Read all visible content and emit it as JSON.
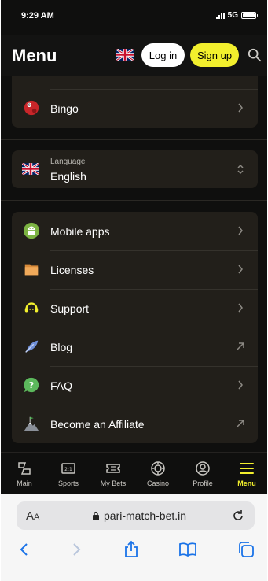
{
  "status": {
    "time": "9:29 AM",
    "network": "5G"
  },
  "header": {
    "title": "Menu",
    "login_label": "Log in",
    "signup_label": "Sign up"
  },
  "menu_top": {
    "items": [
      {
        "label": "Bingo",
        "icon": "bingo-ball-icon"
      }
    ]
  },
  "language": {
    "caption": "Language",
    "value": "English",
    "flag": "uk-flag-icon"
  },
  "menu_bottom": {
    "items": [
      {
        "label": "Mobile apps",
        "icon": "android-icon",
        "action": "chevron"
      },
      {
        "label": "Licenses",
        "icon": "folder-icon",
        "action": "chevron"
      },
      {
        "label": "Support",
        "icon": "headset-icon",
        "action": "chevron"
      },
      {
        "label": "Blog",
        "icon": "feather-icon",
        "action": "external"
      },
      {
        "label": "FAQ",
        "icon": "chat-question-icon",
        "action": "chevron"
      },
      {
        "label": "Become an Affiliate",
        "icon": "mountain-flag-icon",
        "action": "external"
      }
    ]
  },
  "bottom_nav": {
    "items": [
      {
        "label": "Main",
        "icon": "main-icon"
      },
      {
        "label": "Sports",
        "icon": "scoreboard-icon"
      },
      {
        "label": "My Bets",
        "icon": "ticket-icon"
      },
      {
        "label": "Casino",
        "icon": "casino-chip-icon"
      },
      {
        "label": "Profile",
        "icon": "profile-icon"
      },
      {
        "label": "Menu",
        "icon": "hamburger-icon",
        "active": true
      }
    ]
  },
  "browser": {
    "aa_label": "AA",
    "url": "pari-match-bet.in"
  },
  "colors": {
    "accent": "#f2ef2d",
    "background": "#0f0f0e",
    "card": "#221f1a"
  }
}
